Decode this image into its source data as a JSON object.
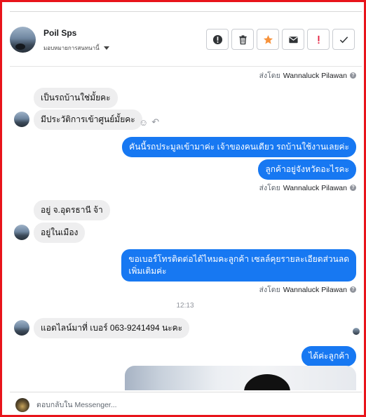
{
  "header": {
    "contact_name": "Poil Sps",
    "assign_label": "มอบหมายการสนทนานี้",
    "actions": [
      {
        "name": "alert-icon",
        "label": "!"
      },
      {
        "name": "trash-icon",
        "label": ""
      },
      {
        "name": "star-icon",
        "label": ""
      },
      {
        "name": "mail-icon",
        "label": ""
      },
      {
        "name": "spam-icon",
        "label": "!"
      },
      {
        "name": "check-icon",
        "label": ""
      }
    ]
  },
  "messages": {
    "sent_by_prefix": "ส่งโดย",
    "agent_name": "Wannaluck Pilawan",
    "m1": "เป็นรถบ้านใช่มั้ยคะ",
    "m2": "มีประวัติการเข้าศูนย์มั้ยคะ",
    "m3": "คันนี้รถประมูลเข้ามาค่ะ   เจ้าของคนเดียว รถบ้านใช้งานเลยค่ะ",
    "m4": "ลูกค้าอยู่จังหวัดอะไรคะ",
    "m5": "อยู่ จ.อุดรธานี จ้า",
    "m6": "อยู่ในเมือง",
    "m7_line1": "ขอเบอร์โทรติดต่อได้ไหมคะลูกค้า  เซลล์คุยรายละเอียดส่วนลด",
    "m7_line2": "เพิ่มเติมค่ะ",
    "time_divider": "12:13",
    "m8": "แอดไลน์มาที่ เบอร์ 063-9241494 นะคะ",
    "m9": "ได้ค่ะลูกค้า"
  },
  "composer": {
    "placeholder": "ตอบกลับใน Messenger..."
  },
  "colors": {
    "outgoing": "#1778f2",
    "incoming": "#eeeeef",
    "frame": "#e8141b",
    "star": "#f7923b",
    "spam": "#e41e3f"
  }
}
